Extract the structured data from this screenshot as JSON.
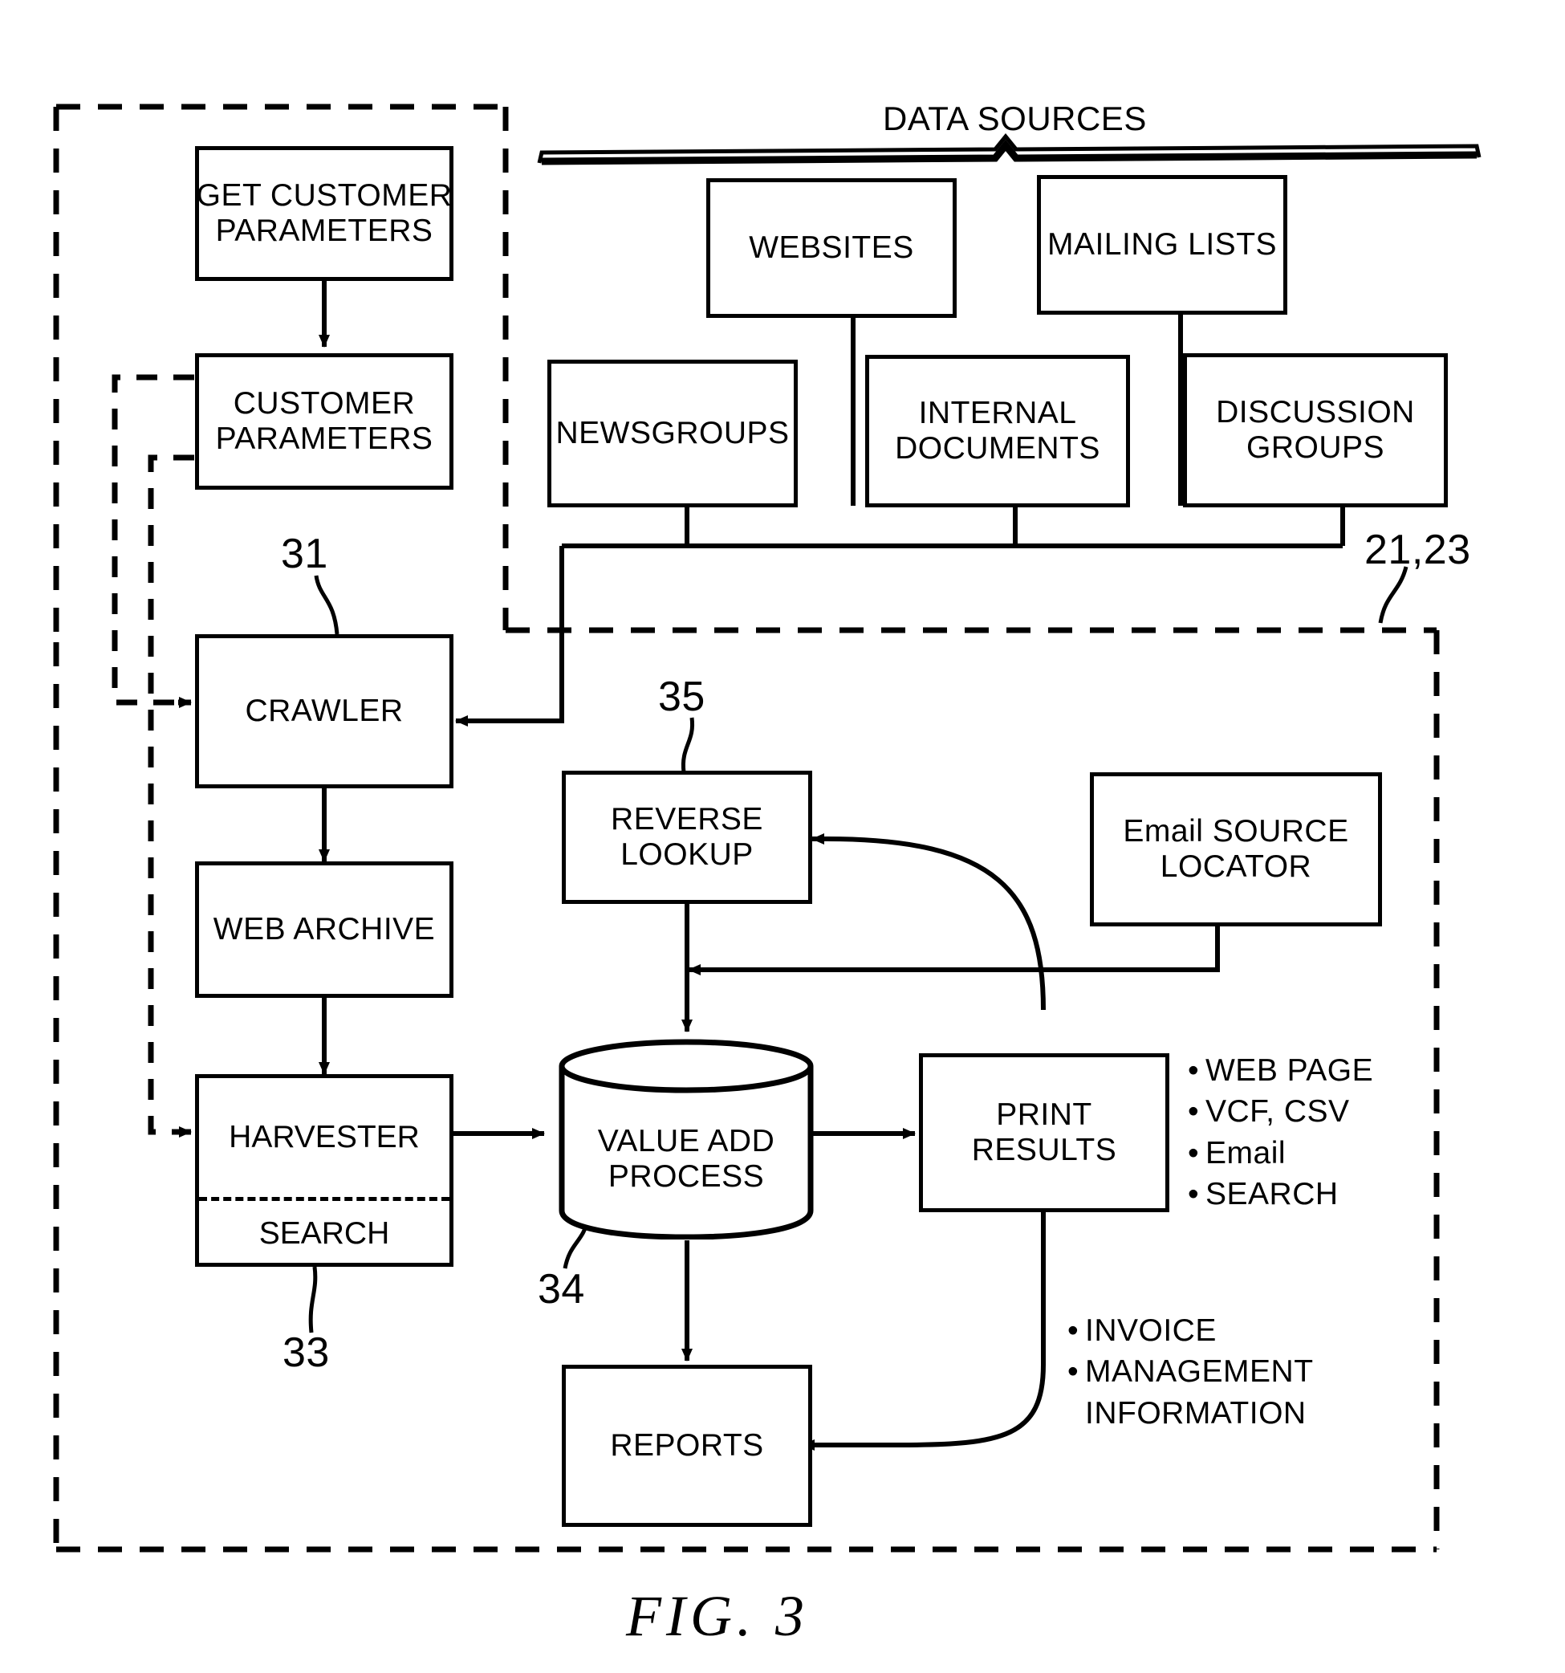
{
  "figure": {
    "caption": "FIG.  3",
    "data_sources_label": "DATA SOURCES"
  },
  "reference_numerals": {
    "crawler": "31",
    "harvester": "33",
    "value_add": "34",
    "reverse_lookup": "35",
    "system_boundary": "21,23"
  },
  "nodes": {
    "get_customer_parameters": {
      "line1": "GET CUSTOMER",
      "line2": "PARAMETERS"
    },
    "customer_parameters": {
      "line1": "CUSTOMER",
      "line2": "PARAMETERS"
    },
    "websites": {
      "line1": "WEBSITES"
    },
    "mailing_lists": {
      "line1": "MAILING LISTS"
    },
    "newsgroups": {
      "line1": "NEWSGROUPS"
    },
    "internal_documents": {
      "line1": "INTERNAL",
      "line2": "DOCUMENTS"
    },
    "discussion_groups": {
      "line1": "DISCUSSION",
      "line2": "GROUPS"
    },
    "crawler": {
      "line1": "CRAWLER"
    },
    "web_archive": {
      "line1": "WEB ARCHIVE"
    },
    "harvester": {
      "line1": "HARVESTER"
    },
    "search": {
      "line1": "SEARCH"
    },
    "reverse_lookup": {
      "line1": "REVERSE",
      "line2": "LOOKUP"
    },
    "email_source_locator": {
      "line1": "Email SOURCE",
      "line2": "LOCATOR"
    },
    "value_add_process": {
      "line1": "VALUE ADD",
      "line2": "PROCESS"
    },
    "print_results": {
      "line1": "PRINT",
      "line2": "RESULTS"
    },
    "reports": {
      "line1": "REPORTS"
    }
  },
  "output_formats": {
    "items": [
      "WEB PAGE",
      "VCF, CSV",
      "Email",
      "SEARCH"
    ]
  },
  "management_outputs": {
    "items": [
      "INVOICE",
      "MANAGEMENT"
    ],
    "continuation": "INFORMATION"
  },
  "colors": {
    "ink": "#000000",
    "paper": "#ffffff"
  }
}
